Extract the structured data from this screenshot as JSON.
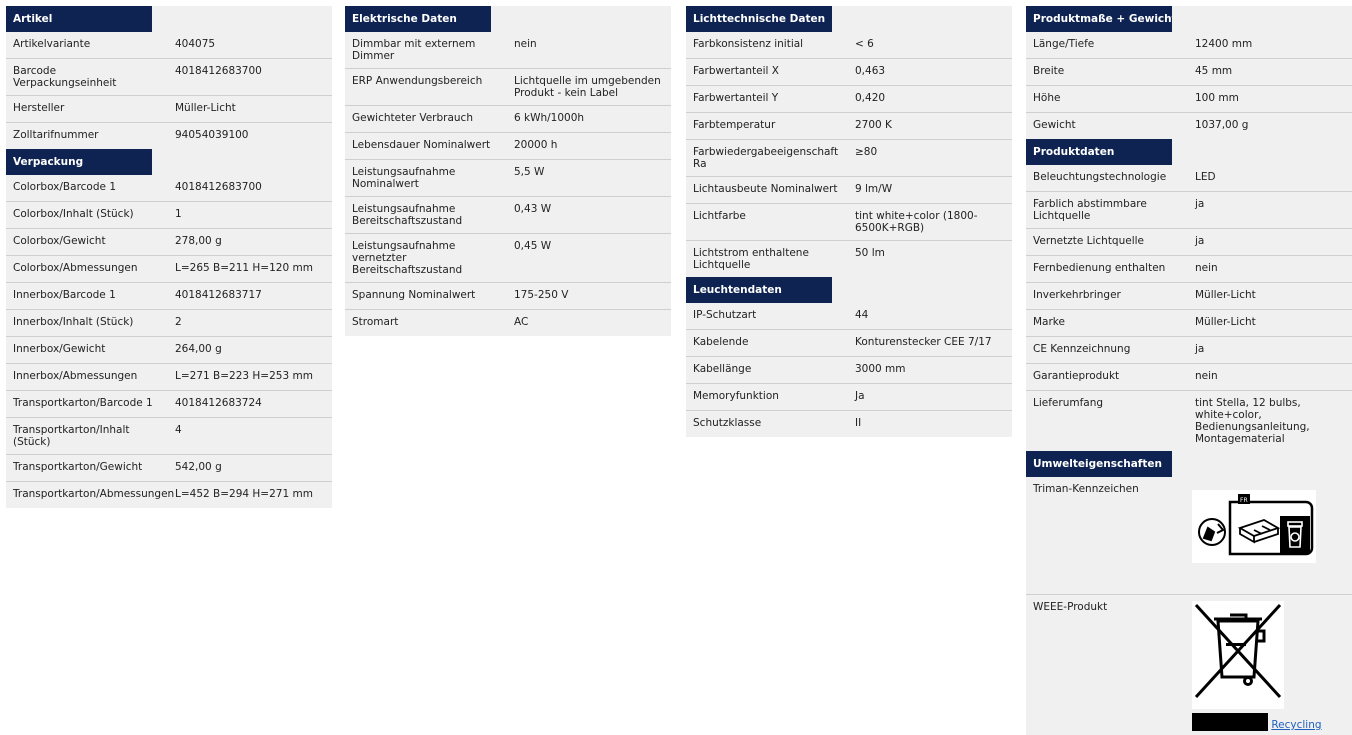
{
  "col1": {
    "sections": [
      {
        "title": "Artikel",
        "rows": [
          {
            "k": "Artikelvariante",
            "v": "404075"
          },
          {
            "k": "Barcode Verpackungseinheit",
            "v": "4018412683700"
          },
          {
            "k": "Hersteller",
            "v": "Müller-Licht"
          },
          {
            "k": "Zolltarifnummer",
            "v": "94054039100"
          }
        ]
      },
      {
        "title": "Verpackung",
        "rows": [
          {
            "k": "Colorbox/Barcode 1",
            "v": "4018412683700"
          },
          {
            "k": "Colorbox/Inhalt (Stück)",
            "v": "1"
          },
          {
            "k": "Colorbox/Gewicht",
            "v": "278,00 g"
          },
          {
            "k": "Colorbox/Abmessungen",
            "v": "L=265 B=211 H=120 mm"
          },
          {
            "k": "Innerbox/Barcode 1",
            "v": "4018412683717"
          },
          {
            "k": "Innerbox/Inhalt (Stück)",
            "v": "2"
          },
          {
            "k": "Innerbox/Gewicht",
            "v": "264,00 g"
          },
          {
            "k": "Innerbox/Abmessungen",
            "v": "L=271 B=223 H=253 mm"
          },
          {
            "k": "Transportkarton/Barcode 1",
            "v": "4018412683724"
          },
          {
            "k": "Transportkarton/Inhalt (Stück)",
            "v": "4"
          },
          {
            "k": "Transportkarton/Gewicht",
            "v": "542,00 g"
          },
          {
            "k": "Transportkarton/Abmessungen",
            "v": "L=452 B=294 H=271 mm"
          }
        ]
      }
    ]
  },
  "col2": {
    "sections": [
      {
        "title": "Elektrische Daten",
        "rows": [
          {
            "k": "Dimmbar mit externem Dimmer",
            "v": "nein"
          },
          {
            "k": "ERP Anwendungsbereich",
            "v": "Lichtquelle im umgebenden Produkt - kein Label"
          },
          {
            "k": "Gewichteter Verbrauch",
            "v": "6 kWh/1000h"
          },
          {
            "k": "Lebensdauer Nominalwert",
            "v": "20000 h"
          },
          {
            "k": "Leistungsaufnahme Nominalwert",
            "v": "5,5 W"
          },
          {
            "k": "Leistungsaufnahme Bereitschaftszustand",
            "v": "0,43 W"
          },
          {
            "k": "Leistungsaufnahme vernetzter Bereitschaftszustand",
            "v": "0,45 W"
          },
          {
            "k": "Spannung Nominalwert",
            "v": "175-250 V"
          },
          {
            "k": "Stromart",
            "v": "AC"
          }
        ]
      }
    ]
  },
  "col3": {
    "sections": [
      {
        "title": "Lichttechnische Daten",
        "rows": [
          {
            "k": "Farbkonsistenz initial",
            "v": "< 6"
          },
          {
            "k": "Farbwertanteil X",
            "v": "0,463"
          },
          {
            "k": "Farbwertanteil Y",
            "v": "0,420"
          },
          {
            "k": "Farbtemperatur",
            "v": "2700 K"
          },
          {
            "k": "Farbwiedergabeeigenschaft Ra",
            "v": "≥80"
          },
          {
            "k": "Lichtausbeute Nominalwert",
            "v": "9 lm/W"
          },
          {
            "k": "Lichtfarbe",
            "v": "tint white+color (1800-6500K+RGB)"
          },
          {
            "k": "Lichtstrom enthaltene Lichtquelle",
            "v": "50 lm"
          }
        ]
      },
      {
        "title": "Leuchtendaten",
        "rows": [
          {
            "k": "IP-Schutzart",
            "v": "44"
          },
          {
            "k": "Kabelende",
            "v": "Konturenstecker CEE 7/17"
          },
          {
            "k": "Kabellänge",
            "v": "3000 mm"
          },
          {
            "k": "Memoryfunktion",
            "v": "Ja"
          },
          {
            "k": "Schutzklasse",
            "v": "II"
          }
        ]
      }
    ]
  },
  "col4": {
    "sections": [
      {
        "title": "Produktmaße + Gewicht",
        "rows": [
          {
            "k": "Länge/Tiefe",
            "v": "12400 mm"
          },
          {
            "k": "Breite",
            "v": "45 mm"
          },
          {
            "k": "Höhe",
            "v": "100 mm"
          },
          {
            "k": "Gewicht",
            "v": "1037,00 g"
          }
        ]
      },
      {
        "title": "Produktdaten",
        "rows": [
          {
            "k": "Beleuchtungstechnologie",
            "v": "LED"
          },
          {
            "k": "Farblich abstimmbare Lichtquelle",
            "v": "ja"
          },
          {
            "k": "Vernetzte Lichtquelle",
            "v": "ja"
          },
          {
            "k": "Fernbedienung enthalten",
            "v": "nein"
          },
          {
            "k": "Inverkehrbringer",
            "v": "Müller-Licht"
          },
          {
            "k": "Marke",
            "v": "Müller-Licht"
          },
          {
            "k": "CE Kennzeichnung",
            "v": "ja"
          },
          {
            "k": "Garantieprodukt",
            "v": "nein"
          },
          {
            "k": "Lieferumfang",
            "v": "tint Stella, 12 bulbs, white+color, Bedienungsanleitung, Montagematerial"
          }
        ]
      }
    ],
    "env": {
      "title": "Umwelteigenschaften",
      "triman_label": "Triman-Kennzeichen",
      "triman_country": "FR",
      "weee_label": "WEEE-Produkt",
      "recycling_link": "Recycling"
    }
  },
  "colors": {
    "header_bg": "#0e2352",
    "row_bg": "#f0f0f0",
    "link": "#1f5fbf"
  }
}
